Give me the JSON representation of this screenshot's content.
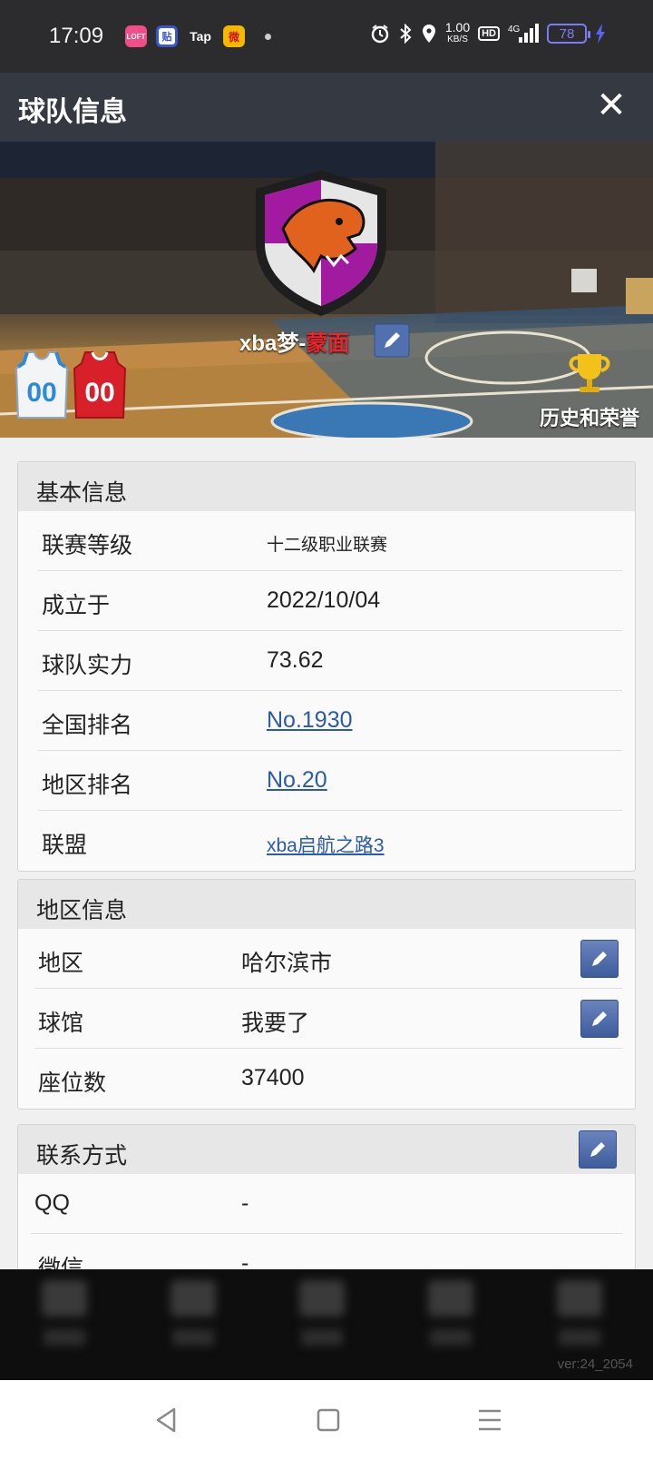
{
  "status_bar": {
    "time": "17:09",
    "apps": [
      {
        "name": "lofter-app-icon",
        "text": "Lofter",
        "color": "#ef4f86"
      },
      {
        "name": "tieba-app-icon",
        "text": "贴",
        "color": "#3656d6"
      },
      {
        "name": "taptap-app-icon",
        "text": "Tap",
        "color": "#2c2c2e"
      },
      {
        "name": "weibo-app-icon",
        "text": "微",
        "color": "#f5b800"
      }
    ],
    "net_speed": "1.00",
    "net_unit": "KB/S",
    "hd": "HD",
    "network": "4G",
    "battery": "78"
  },
  "header": {
    "title": "球队信息",
    "close_icon": "close-icon"
  },
  "banner": {
    "team_name_prefix": "xba梦-",
    "team_name_suffix": "蒙面",
    "jersey_number_home": "00",
    "jersey_number_away": "00",
    "honors_label": "历史和荣誉"
  },
  "basic_info": {
    "heading": "基本信息",
    "rows": [
      {
        "label": "联赛等级",
        "value": "十二级职业联赛"
      },
      {
        "label": "成立于",
        "value": "2022/10/04"
      },
      {
        "label": "球队实力",
        "value": "73.62"
      },
      {
        "label": "全国排名",
        "value": "No.1930"
      },
      {
        "label": "地区排名",
        "value": "No.20"
      },
      {
        "label": "联盟",
        "value": "xba启航之路3"
      }
    ]
  },
  "region_info": {
    "heading": "地区信息",
    "rows": [
      {
        "label": "地区",
        "value": "哈尔滨市"
      },
      {
        "label": "球馆",
        "value": "我要了"
      },
      {
        "label": "座位数",
        "value": "37400"
      }
    ]
  },
  "contact_info": {
    "heading": "联系方式",
    "rows": [
      {
        "label": "QQ",
        "value": "-"
      },
      {
        "label": "微信",
        "value": "-"
      }
    ]
  },
  "footer": {
    "version": "ver:24_2054"
  },
  "colors": {
    "accent_link": "#2a5aa8",
    "edit_button": "#4a67a6",
    "team_name_red": "#e8262c"
  }
}
